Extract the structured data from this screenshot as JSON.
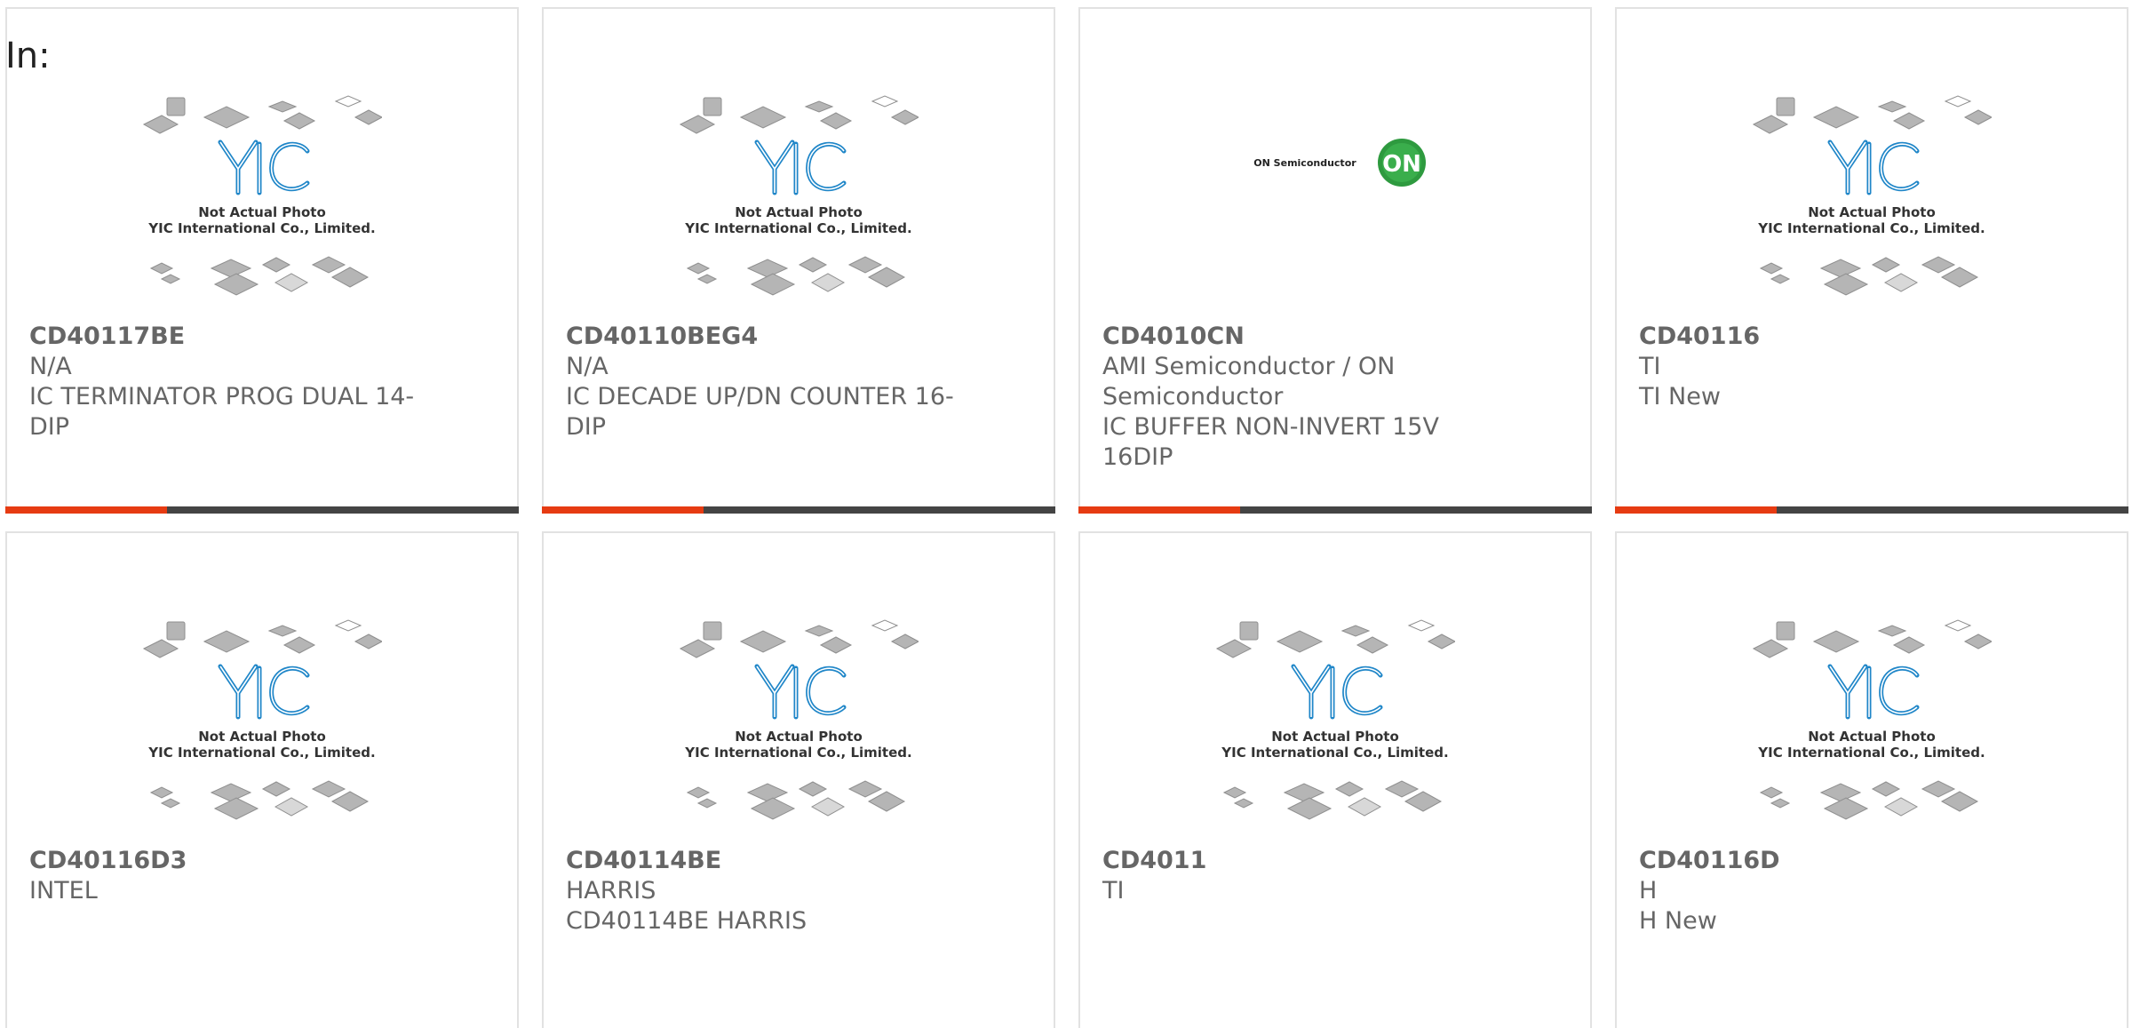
{
  "page": {
    "in_label": "In:"
  },
  "placeholder": {
    "line1": "Not Actual Photo",
    "line2": "YIC International Co., Limited."
  },
  "on_logo": {
    "text": "ON Semiconductor",
    "badge": "ON"
  },
  "colors": {
    "accent": "#e63b12",
    "bar": "#444444",
    "text": "#666666",
    "logo_blue": "#1f86c8",
    "on_green": "#2e9a3f"
  },
  "products": [
    {
      "part": "CD40117BE",
      "line1": "N/A",
      "line2": "IC TERMINATOR PROG DUAL 14-",
      "line3": "DIP",
      "line4": "",
      "image": "yic-placeholder",
      "bar": true
    },
    {
      "part": "CD40110BEG4",
      "line1": "N/A",
      "line2": "IC DECADE UP/DN COUNTER 16-",
      "line3": "DIP",
      "line4": "",
      "image": "yic-placeholder",
      "bar": true
    },
    {
      "part": "CD4010CN",
      "line1": "AMI Semiconductor / ON",
      "line2": "Semiconductor",
      "line3": "IC BUFFER NON-INVERT 15V",
      "line4": "16DIP",
      "image": "on-semiconductor-logo",
      "bar": true
    },
    {
      "part": "CD40116",
      "line1": "TI",
      "line2": "TI New",
      "line3": "",
      "line4": "",
      "image": "yic-placeholder",
      "bar": true
    },
    {
      "part": "CD40116D3",
      "line1": "INTEL",
      "line2": "",
      "line3": "",
      "line4": "",
      "image": "yic-placeholder",
      "bar": false
    },
    {
      "part": "CD40114BE",
      "line1": "HARRIS",
      "line2": "CD40114BE HARRIS",
      "line3": "",
      "line4": "",
      "image": "yic-placeholder",
      "bar": false
    },
    {
      "part": "CD4011",
      "line1": "TI",
      "line2": "",
      "line3": "",
      "line4": "",
      "image": "yic-placeholder",
      "bar": false
    },
    {
      "part": "CD40116D",
      "line1": "H",
      "line2": "H New",
      "line3": "",
      "line4": "",
      "image": "yic-placeholder",
      "bar": false
    }
  ]
}
